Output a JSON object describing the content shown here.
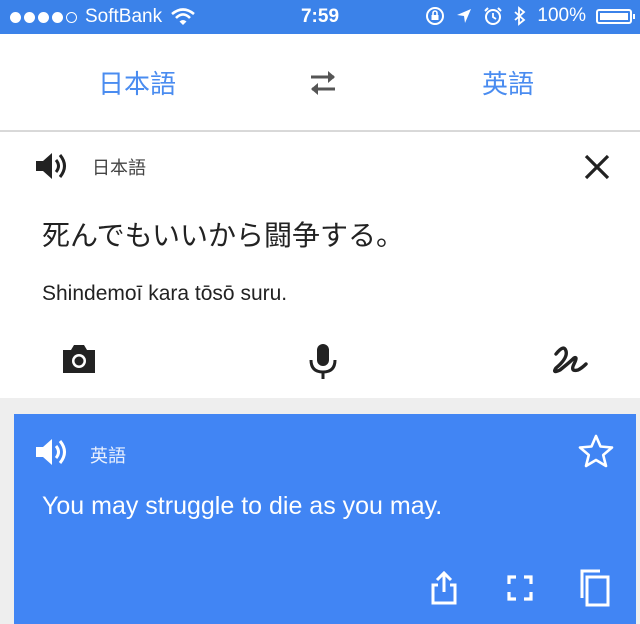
{
  "status": {
    "carrier": "SoftBank",
    "time": "7:59",
    "battery": "100%"
  },
  "langbar": {
    "source": "日本語",
    "target": "英語"
  },
  "input": {
    "lang": "日本語",
    "text": "死んでもいいから闘争する。",
    "romaji": "Shindemoī kara tōsō suru."
  },
  "output": {
    "lang": "英語",
    "text": "You may struggle to die as you may."
  },
  "colors": {
    "accent": "#4185f4",
    "status_bar": "#3b82e9",
    "lang_text": "#4a8cf0"
  }
}
